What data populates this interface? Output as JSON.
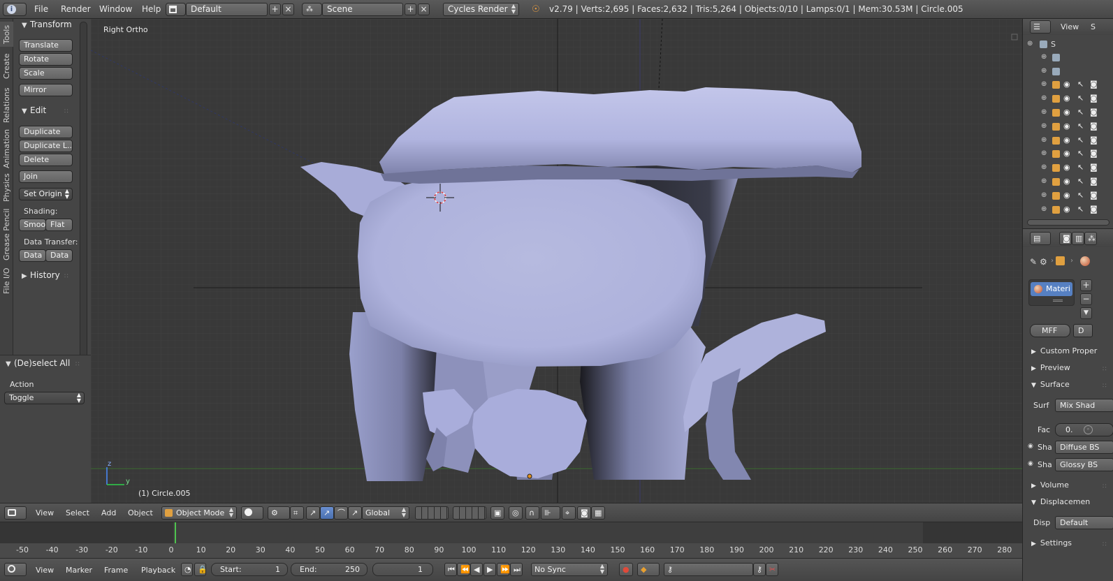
{
  "top_menu": {
    "file": "File",
    "render": "Render",
    "window": "Window",
    "help": "Help"
  },
  "screen_layout": "Default",
  "scene_name": "Scene",
  "render_engine": "Cycles Render",
  "stats": "v2.79 | Verts:2,695 | Faces:2,632 | Tris:5,264 | Objects:0/10 | Lamps:0/1 | Mem:30.53M | Circle.005",
  "tool_tabs": [
    "Tools",
    "Create",
    "Relations",
    "Animation",
    "Physics",
    "Grease Pencil",
    "File I/O"
  ],
  "toolshelf": {
    "transform_title": "Transform",
    "translate": "Translate",
    "rotate": "Rotate",
    "scale": "Scale",
    "mirror": "Mirror",
    "edit_title": "Edit",
    "duplicate": "Duplicate",
    "duplicate_linked": "Duplicate L...",
    "delete": "Delete",
    "join": "Join",
    "set_origin": "Set Origin",
    "shading_label": "Shading:",
    "smooth": "Smoo",
    "flat": "Flat",
    "data_transfer_label": "Data Transfer:",
    "data1": "Data",
    "data2": "Data",
    "history_title": "History"
  },
  "redo_panel": {
    "title": "(De)select All",
    "action_label": "Action",
    "action_value": "Toggle"
  },
  "viewport": {
    "view_name": "Right Ortho",
    "object_label": "(1) Circle.005",
    "axis_z": "z",
    "axis_y": "y"
  },
  "view3d_header": {
    "view": "View",
    "select": "Select",
    "add": "Add",
    "object": "Object",
    "mode": "Object Mode",
    "orientation": "Global"
  },
  "timeline": {
    "ticks": [
      "-50",
      "-40",
      "-30",
      "-20",
      "-10",
      "0",
      "10",
      "20",
      "30",
      "40",
      "50",
      "60",
      "70",
      "80",
      "90",
      "100",
      "110",
      "120",
      "130",
      "140",
      "150",
      "160",
      "170",
      "180",
      "190",
      "200",
      "210",
      "220",
      "230",
      "240",
      "250",
      "260",
      "270",
      "280"
    ],
    "current_frame": 1,
    "view": "View",
    "marker": "Marker",
    "frame": "Frame",
    "playback": "Playback",
    "start_label": "Start:",
    "start_value": "1",
    "end_label": "End:",
    "end_value": "250",
    "frame_value": "1",
    "sync": "No Sync"
  },
  "outliner": {
    "view": "View",
    "scene_item": "S"
  },
  "properties": {
    "material_slot": "Materi",
    "material_field": "MFF",
    "data_btn": "D",
    "custom_props": "Custom Proper",
    "preview": "Preview",
    "surface": "Surface",
    "surf_label": "Surf",
    "surf_value": "Mix Shad",
    "fac_label": "Fac",
    "fac_value": "0.",
    "sha1_label": "Sha",
    "sha1_value": "Diffuse BS",
    "sha2_label": "Sha",
    "sha2_value": "Glossy BS",
    "volume": "Volume",
    "displacement": "Displacemen",
    "disp_label": "Disp",
    "disp_value": "Default",
    "settings": "Settings"
  },
  "colors": {
    "mesh": "#b4b8e0",
    "grid_bg": "#393939",
    "header": "#4a4a4a",
    "accent_selected": "#5680c2"
  }
}
